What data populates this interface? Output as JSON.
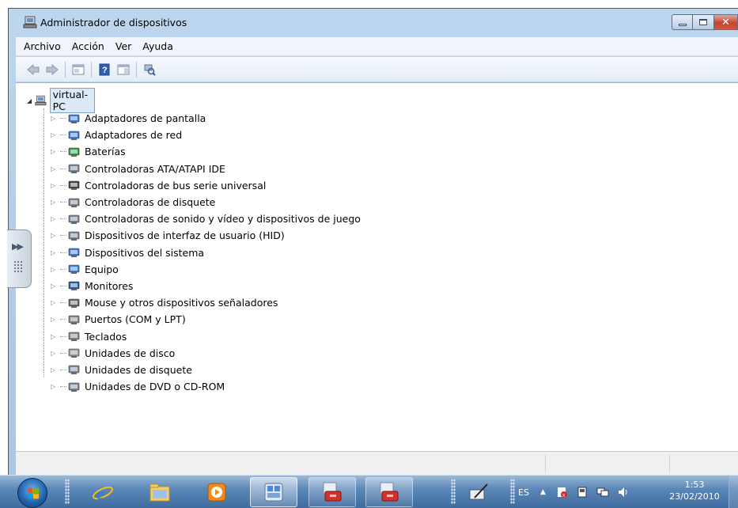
{
  "window": {
    "title": "Administrador de dispositivos",
    "controls": {
      "minimize": "minimize",
      "maximize": "maximize",
      "close": "close"
    }
  },
  "menu": {
    "items": [
      "Archivo",
      "Acción",
      "Ver",
      "Ayuda"
    ]
  },
  "toolbar": {
    "buttons": [
      "back-icon",
      "forward-icon",
      "properties-icon",
      "help-icon",
      "show-hide-icon",
      "scan-icon"
    ]
  },
  "tree": {
    "root": "virtual-PC",
    "items": [
      {
        "label": "Adaptadores de pantalla",
        "icon": "display-adapter-icon"
      },
      {
        "label": "Adaptadores de red",
        "icon": "network-adapter-icon"
      },
      {
        "label": "Baterías",
        "icon": "battery-icon"
      },
      {
        "label": "Controladoras ATA/ATAPI IDE",
        "icon": "ide-controller-icon"
      },
      {
        "label": "Controladoras de bus serie universal",
        "icon": "usb-icon"
      },
      {
        "label": "Controladoras de disquete",
        "icon": "floppy-controller-icon"
      },
      {
        "label": "Controladoras de sonido y vídeo y dispositivos de juego",
        "icon": "sound-icon"
      },
      {
        "label": "Dispositivos de interfaz de usuario (HID)",
        "icon": "hid-icon"
      },
      {
        "label": "Dispositivos del sistema",
        "icon": "system-devices-icon"
      },
      {
        "label": "Equipo",
        "icon": "computer-icon"
      },
      {
        "label": "Monitores",
        "icon": "monitor-icon"
      },
      {
        "label": "Mouse y otros dispositivos señaladores",
        "icon": "mouse-icon"
      },
      {
        "label": "Puertos (COM y LPT)",
        "icon": "port-icon"
      },
      {
        "label": "Teclados",
        "icon": "keyboard-icon"
      },
      {
        "label": "Unidades de disco",
        "icon": "disk-drive-icon"
      },
      {
        "label": "Unidades de disquete",
        "icon": "floppy-drive-icon"
      },
      {
        "label": "Unidades de DVD o CD-ROM",
        "icon": "dvd-drive-icon"
      }
    ]
  },
  "taskbar": {
    "apps": [
      "internet-explorer-icon",
      "windows-explorer-icon",
      "media-player-icon",
      "device-manager-icon",
      "toolbox-icon",
      "toolbox-icon"
    ],
    "language": "ES",
    "time": "1:53",
    "date": "23/02/2010"
  },
  "colors": {
    "accent": "#3f6c9f",
    "selection": "#dce9f7"
  }
}
